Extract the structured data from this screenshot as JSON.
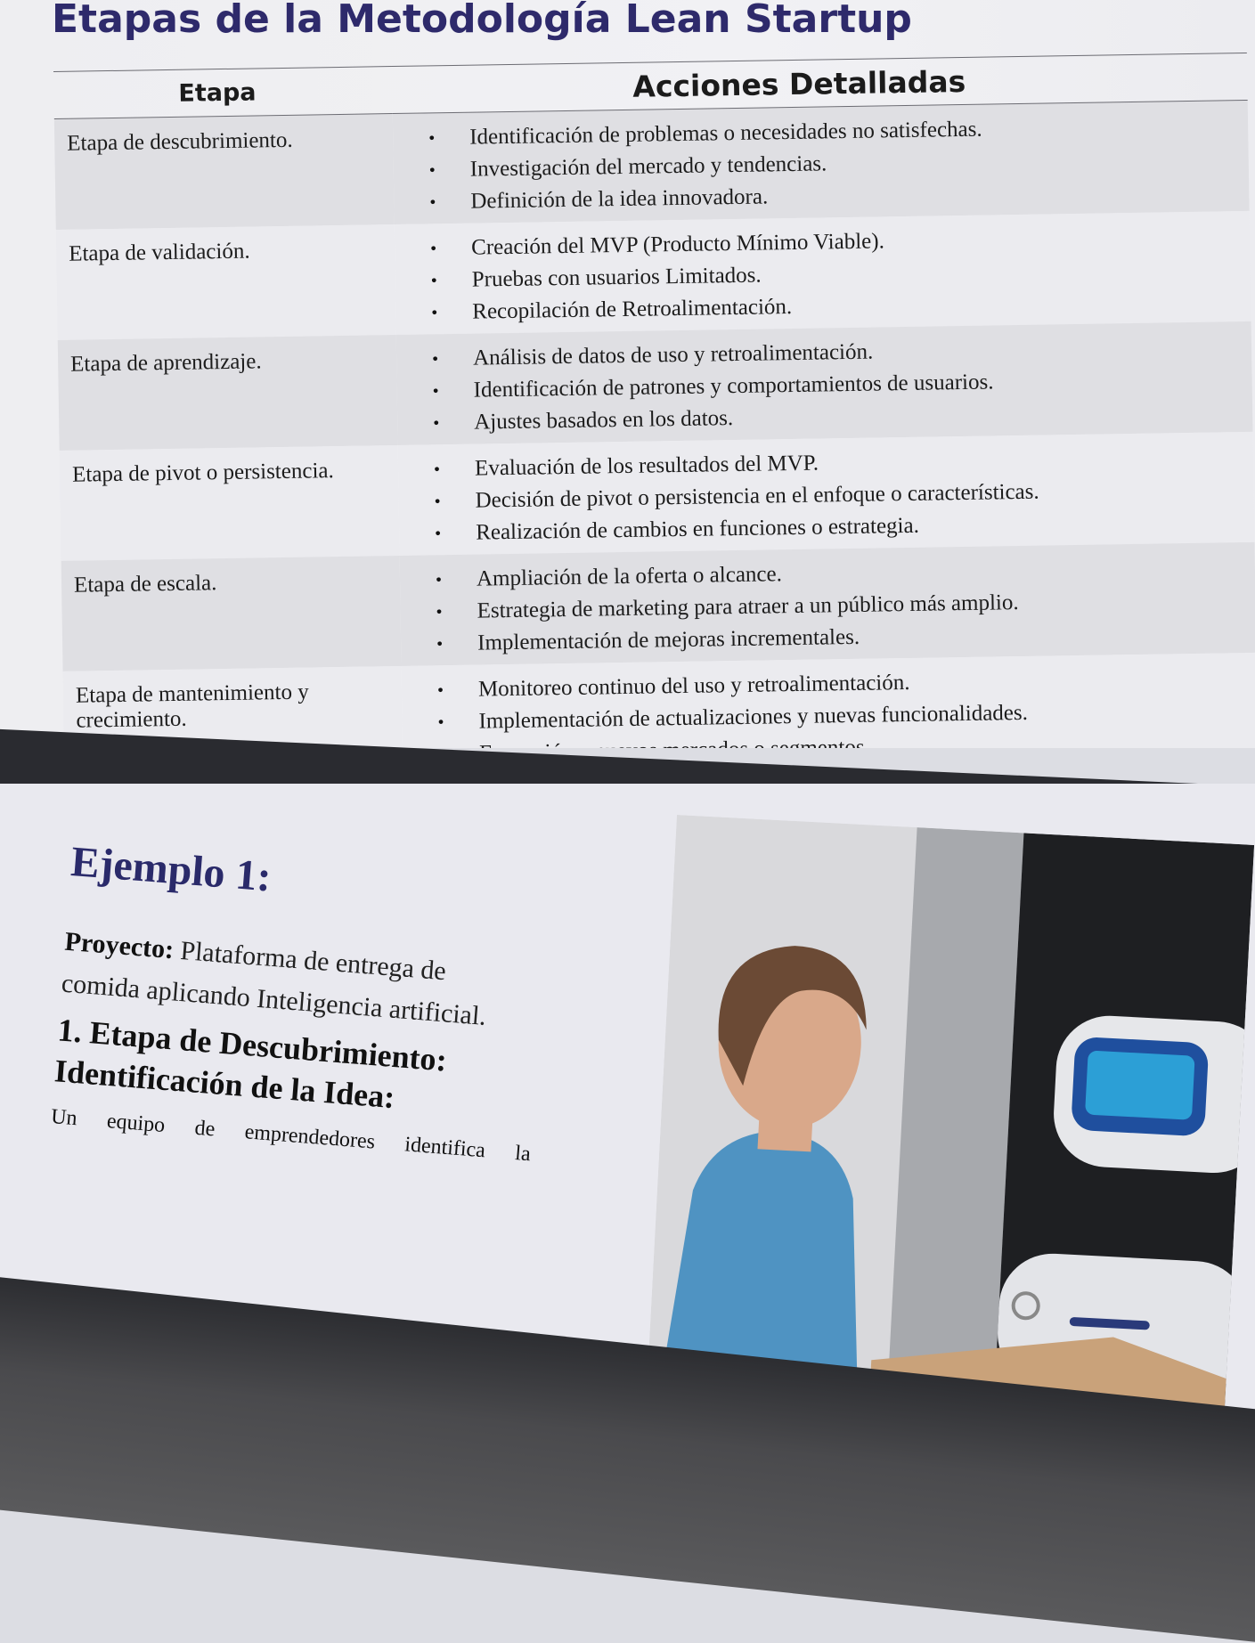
{
  "document": {
    "title": "Etapas de la Metodología Lean Startup",
    "table": {
      "headers": {
        "stage": "Etapa",
        "actions": "Acciones Detalladas"
      },
      "rows": [
        {
          "stage": "Etapa de descubrimiento.",
          "actions": [
            "Identificación de problemas o necesidades no satisfechas.",
            "Investigación del mercado y tendencias.",
            "Definición de la idea innovadora."
          ]
        },
        {
          "stage": "Etapa de validación.",
          "actions": [
            "Creación del MVP (Producto Mínimo Viable).",
            "Pruebas con usuarios Limitados.",
            "Recopilación de Retroalimentación."
          ]
        },
        {
          "stage": "Etapa de aprendizaje.",
          "actions": [
            "Análisis de datos de uso y retroalimentación.",
            "Identificación de patrones y comportamientos de usuarios.",
            "Ajustes basados en los datos."
          ]
        },
        {
          "stage": "Etapa de pivot o persistencia.",
          "actions": [
            "Evaluación de los resultados del MVP.",
            "Decisión de pivot o persistencia en el enfoque o características.",
            "Realización de cambios en funciones o estrategia."
          ]
        },
        {
          "stage": "Etapa de escala.",
          "actions": [
            "Ampliación de la oferta o alcance.",
            "Estrategia de marketing para atraer a un público más amplio.",
            "Implementación de mejoras incrementales."
          ]
        },
        {
          "stage": "Etapa de mantenimiento y crecimiento.",
          "actions": [
            "Monitoreo continuo del uso y retroalimentación.",
            "Implementación de actualizaciones y nuevas funcionalidades.",
            "Expansión a nuevos mercados o segmentos."
          ]
        }
      ]
    }
  },
  "example": {
    "title": "Ejemplo 1:",
    "project_label": "Proyecto:",
    "project_text": "Plataforma de entrega de comida aplicando Inteligencia artificial.",
    "step_heading": "1. Etapa de Descubrimiento:",
    "idea_heading": "Identificación de la Idea:",
    "idea_text": "Un equipo de emprendedores identifica la"
  },
  "colors": {
    "title": "#2e2a6b",
    "row_shade": "#dfdfe3",
    "bezel": "#2a2b30",
    "robot_screen": "#2c9fd6"
  }
}
